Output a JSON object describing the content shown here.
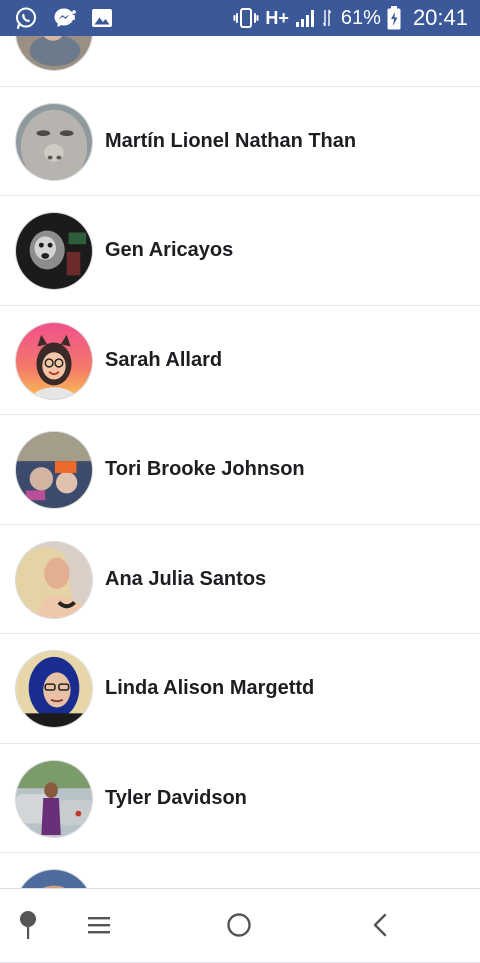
{
  "status_bar": {
    "background": "#3b5998",
    "network_type": "H+",
    "battery_percent": "61%",
    "time": "20:41",
    "left_icons": [
      "whatsapp-icon",
      "messenger-notification-icon",
      "gallery-icon"
    ],
    "right_icons": [
      "vibrate-icon",
      "network-type-icon",
      "signal-icon",
      "data-arrows-icon",
      "battery-charging-icon"
    ]
  },
  "friends": [
    {
      "name": "",
      "avatar": "avatar-photo-partial"
    },
    {
      "name": "Martín Lionel Nathan Than",
      "avatar": "avatar-photo"
    },
    {
      "name": "Gen Aricayos",
      "avatar": "avatar-photo"
    },
    {
      "name": "Sarah Allard",
      "avatar": "avatar-illustration"
    },
    {
      "name": "Tori Brooke Johnson",
      "avatar": "avatar-photo"
    },
    {
      "name": "Ana Julia Santos",
      "avatar": "avatar-photo"
    },
    {
      "name": "Linda Alison Margettd",
      "avatar": "avatar-photo"
    },
    {
      "name": "Tyler Davidson",
      "avatar": "avatar-photo"
    },
    {
      "name": "",
      "avatar": "avatar-photo-partial"
    }
  ],
  "nav_bar": {
    "icons": [
      "pin-icon",
      "menu-icon",
      "home-icon",
      "back-icon"
    ]
  },
  "colors": {
    "accent": "#3b5998",
    "name_text": "#1c1e21",
    "divider": "#e4e6eb"
  }
}
